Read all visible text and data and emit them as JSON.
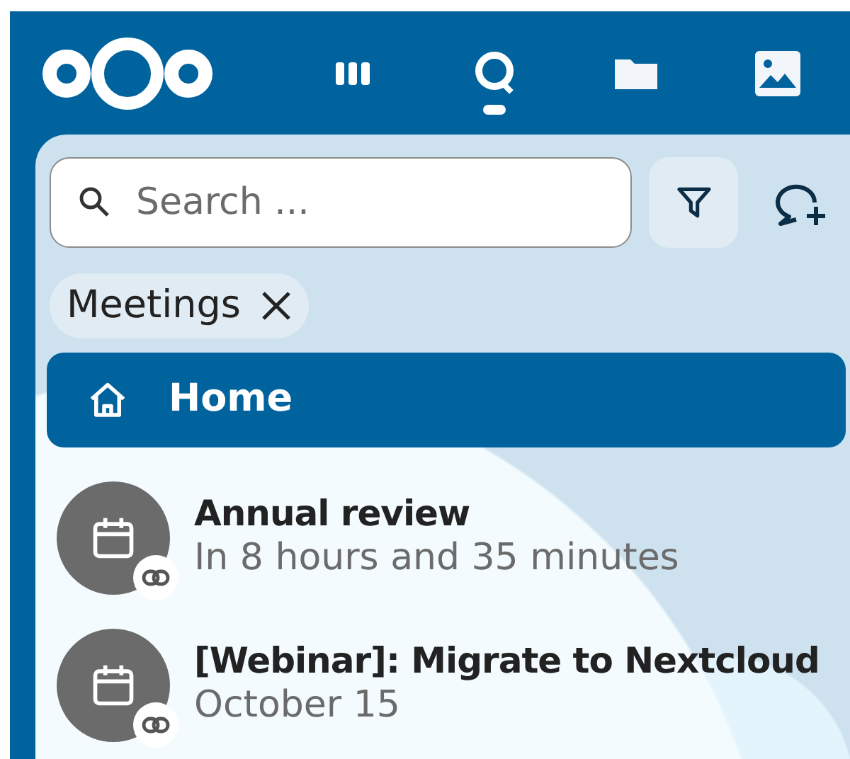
{
  "header": {
    "apps": [
      {
        "kind": "dashboard",
        "selected": false
      },
      {
        "kind": "talk",
        "selected": true
      },
      {
        "kind": "files",
        "selected": false
      },
      {
        "kind": "photos",
        "selected": false
      }
    ]
  },
  "search": {
    "placeholder": "Search ..."
  },
  "filters": [
    {
      "label": "Meetings"
    }
  ],
  "navigation": [
    {
      "label": "Home",
      "selected": true
    }
  ],
  "conversations": [
    {
      "title": "Annual review",
      "subtitle": "In 8 hours and 35 minutes"
    },
    {
      "title": "[Webinar]: Migrate to Nextcloud",
      "subtitle": "October 15"
    }
  ]
}
